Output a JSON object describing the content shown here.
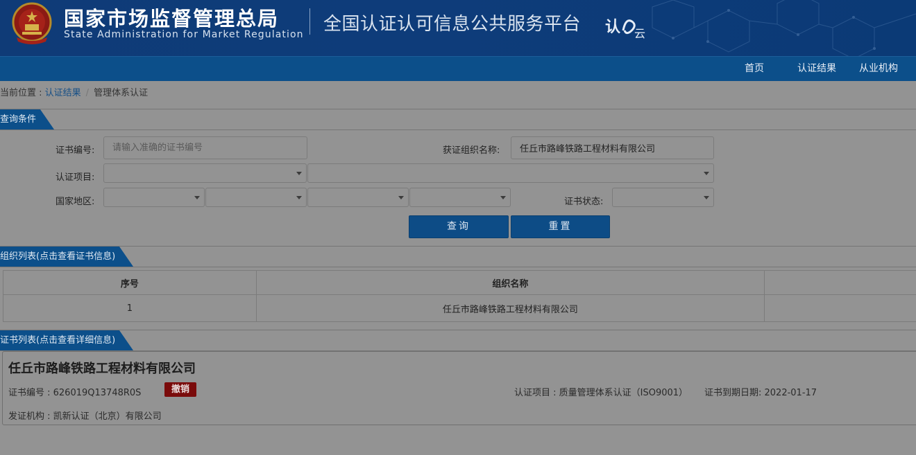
{
  "header": {
    "agency_zh": "国家市场监督管理总局",
    "agency_en": "State Administration  for  Market Regulation",
    "platform_title": "全国认证认可信息公共服务平台",
    "cloud_logo_text_1": "认",
    "cloud_logo_text_2": "云"
  },
  "nav": {
    "items": [
      {
        "label": "首页"
      },
      {
        "label": "认证结果"
      },
      {
        "label": "从业机构"
      }
    ]
  },
  "breadcrumb": {
    "prefix": "当前位置 : ",
    "link": "认证结果",
    "separator": "/",
    "current": "管理体系认证"
  },
  "query_section": {
    "title": "查询条件",
    "cert_no_label": "证书编号:",
    "cert_no_placeholder": "请输入准确的证书编号",
    "org_name_label": "获证组织名称:",
    "org_name_value": "任丘市路峰铁路工程材料有限公司",
    "project_label": "认证项目:",
    "region_label": "国家地区:",
    "status_label": "证书状态:",
    "search_button": "查询",
    "reset_button": "重置"
  },
  "org_section": {
    "title": "组织列表(点击查看证书信息)",
    "columns": [
      "序号",
      "组织名称",
      ""
    ],
    "rows": [
      {
        "index": "1",
        "name": "任丘市路峰铁路工程材料有限公司"
      }
    ]
  },
  "cert_section": {
    "title": "证书列表(点击查看详细信息)",
    "org_name": "任丘市路峰铁路工程材料有限公司",
    "cert_no": "证书编号 : 626019Q13748R0S",
    "status_badge": "撤销",
    "project": "认证项目 : 质量管理体系认证（ISO9001）",
    "expiry": "证书到期日期: 2022-01-17",
    "issuer": "发证机构 : 凯新认证（北京）有限公司"
  },
  "colors": {
    "header_bg": "#0f3b77",
    "nav_bg": "#0c4f8a",
    "button_bg": "#0d4c86",
    "badge_bg": "#7a0b0b",
    "overlay_bg": "#939393"
  }
}
